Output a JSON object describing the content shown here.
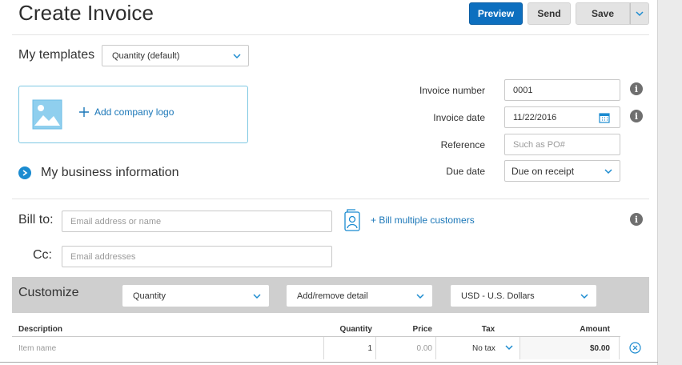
{
  "header": {
    "title": "Create Invoice",
    "preview_label": "Preview",
    "send_label": "Send",
    "save_label": "Save"
  },
  "templates": {
    "label": "My templates",
    "selected": "Quantity (default)"
  },
  "logo": {
    "add_label": "Add company logo"
  },
  "business": {
    "label": "My business information"
  },
  "invoice": {
    "number_label": "Invoice number",
    "number_value": "0001",
    "date_label": "Invoice date",
    "date_value": "11/22/2016",
    "reference_label": "Reference",
    "reference_placeholder": "Such as PO#",
    "due_label": "Due date",
    "due_value": "Due on receipt"
  },
  "bill": {
    "to_label": "Bill to:",
    "to_placeholder": "Email address or name",
    "cc_label": "Cc:",
    "cc_placeholder": "Email addresses",
    "multiple_label": "+ Bill multiple customers"
  },
  "customize": {
    "label": "Customize",
    "quantity_select": "Quantity",
    "detail_select": "Add/remove detail",
    "currency_select": "USD - U.S. Dollars"
  },
  "table": {
    "headers": {
      "description": "Description",
      "quantity": "Quantity",
      "price": "Price",
      "tax": "Tax",
      "amount": "Amount"
    },
    "rows": [
      {
        "item_placeholder": "Item name",
        "quantity": "1",
        "price": "0.00",
        "tax": "No tax",
        "amount": "$0.00"
      }
    ]
  },
  "colors": {
    "primary": "#0d6fbf",
    "link": "#1b77b8",
    "customize_bar": "#cfcfcf",
    "accent_border": "#7ec8e3"
  }
}
